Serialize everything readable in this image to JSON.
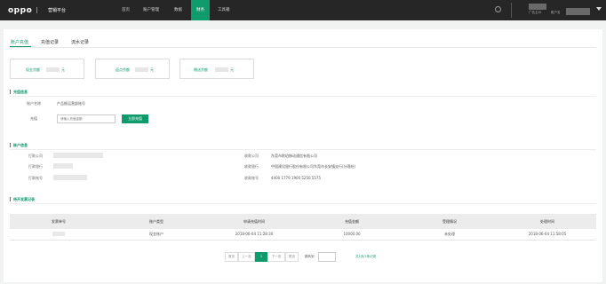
{
  "header": {
    "logo": "oppo",
    "platform": "营销平台",
    "nav": [
      {
        "label": "首页"
      },
      {
        "label": "账户管理"
      },
      {
        "label": "数据"
      },
      {
        "label": "财务",
        "active": true
      },
      {
        "label": "工具箱"
      }
    ],
    "user": {
      "label_a": "广告主ID",
      "label_b": "账户名"
    }
  },
  "tabs": [
    {
      "label": "账户充值",
      "active": true
    },
    {
      "label": "充值记录"
    },
    {
      "label": "流水记录"
    }
  ],
  "balances": [
    {
      "label": "现金余额",
      "suffix": "元"
    },
    {
      "label": "返点余额",
      "suffix": "元"
    },
    {
      "label": "赠送余额",
      "suffix": "元"
    }
  ],
  "recharge": {
    "title": "充值信息",
    "name_label": "账户名称",
    "name_value": "产品推运营部账号",
    "amount_label": "充值",
    "amount_placeholder": "请输入充值金额",
    "submit_label": "立即充值"
  },
  "account": {
    "title": "账户信息",
    "left": [
      {
        "label": "打款公司"
      },
      {
        "label": "打款银行"
      },
      {
        "label": "打款账号"
      }
    ],
    "right": [
      {
        "label": "收款公司",
        "value": "东莞市欧珀移动通信有限公司"
      },
      {
        "label": "收款银行",
        "value": "中国建设银行股份有限公司东莞市长安镇支行(分理处)"
      },
      {
        "label": "收款账号",
        "value": "4400 1779 1900 5250 5575"
      }
    ]
  },
  "pending": {
    "title": "待开发票记录",
    "columns": [
      "发票单号",
      "账户类型",
      "申请充值时间",
      "充值金额",
      "受理情况",
      "处理时间"
    ],
    "rows": [
      [
        "",
        "现金账户",
        "2018-06-04 11:28:30",
        "10000.00",
        "未处理",
        "2018-06-04 11:58:05"
      ]
    ]
  },
  "pagination": {
    "first": "首页",
    "prev": "上一页",
    "current": "1",
    "next": "下一页",
    "last": "尾页",
    "jump_label": "跳转到",
    "total": "共1页/1条记录"
  },
  "colors": {
    "accent": "#0f9b6c",
    "topbar": "#262626"
  }
}
